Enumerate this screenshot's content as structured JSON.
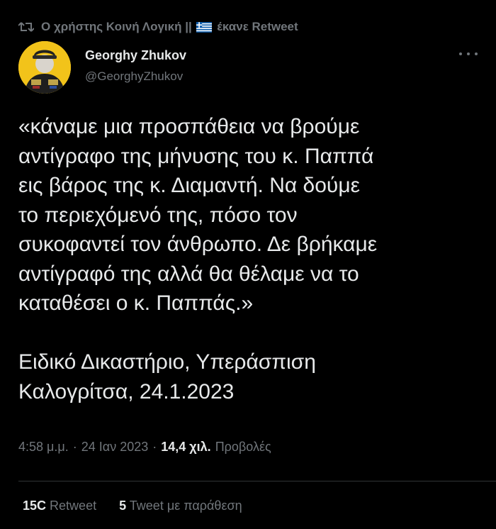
{
  "retweet": {
    "icon": "retweet-icon",
    "user_before_flag": "Ο χρήστης Κοινή Λογική ||",
    "flag": "greek-flag-icon",
    "action": "έκανε Retweet"
  },
  "author": {
    "name": "Georghy Zhukov",
    "handle": "@GeorghyZhukov",
    "avatar": "avatar-portrait"
  },
  "tweet": {
    "text": "«κάναμε μια προσπάθεια να βρούμε\nαντίγραφο της μήνυσης του κ. Παππά\nεις βάρος της κ. Διαμαντή. Να δούμε\nτο περιεχόμενό της, πόσο τον\nσυκοφαντεί τον άνθρωπο. Δε βρήκαμε\nαντίγραφό της αλλά θα θέλαμε να το\nκαταθέσει ο κ. Παππάς.»\n\nΕιδικό Δικαστήριο, Υπεράσπιση\nΚαλογρίτσα, 24.1.2023"
  },
  "meta": {
    "time": "4:58 μ.μ.",
    "sep1": "·",
    "date": "24 Ιαν 2023",
    "sep2": "·",
    "views_count": "14,4 χιλ.",
    "views_label": "Προβολές"
  },
  "stats": {
    "retweets_count": "15C",
    "retweets_label": "Retweet",
    "quotes_count": "5",
    "quotes_label": "Tweet με παράθεση"
  },
  "colors": {
    "background": "#000000",
    "text": "#e7e9ea",
    "secondary": "#71767b",
    "divider": "#2f3336"
  }
}
